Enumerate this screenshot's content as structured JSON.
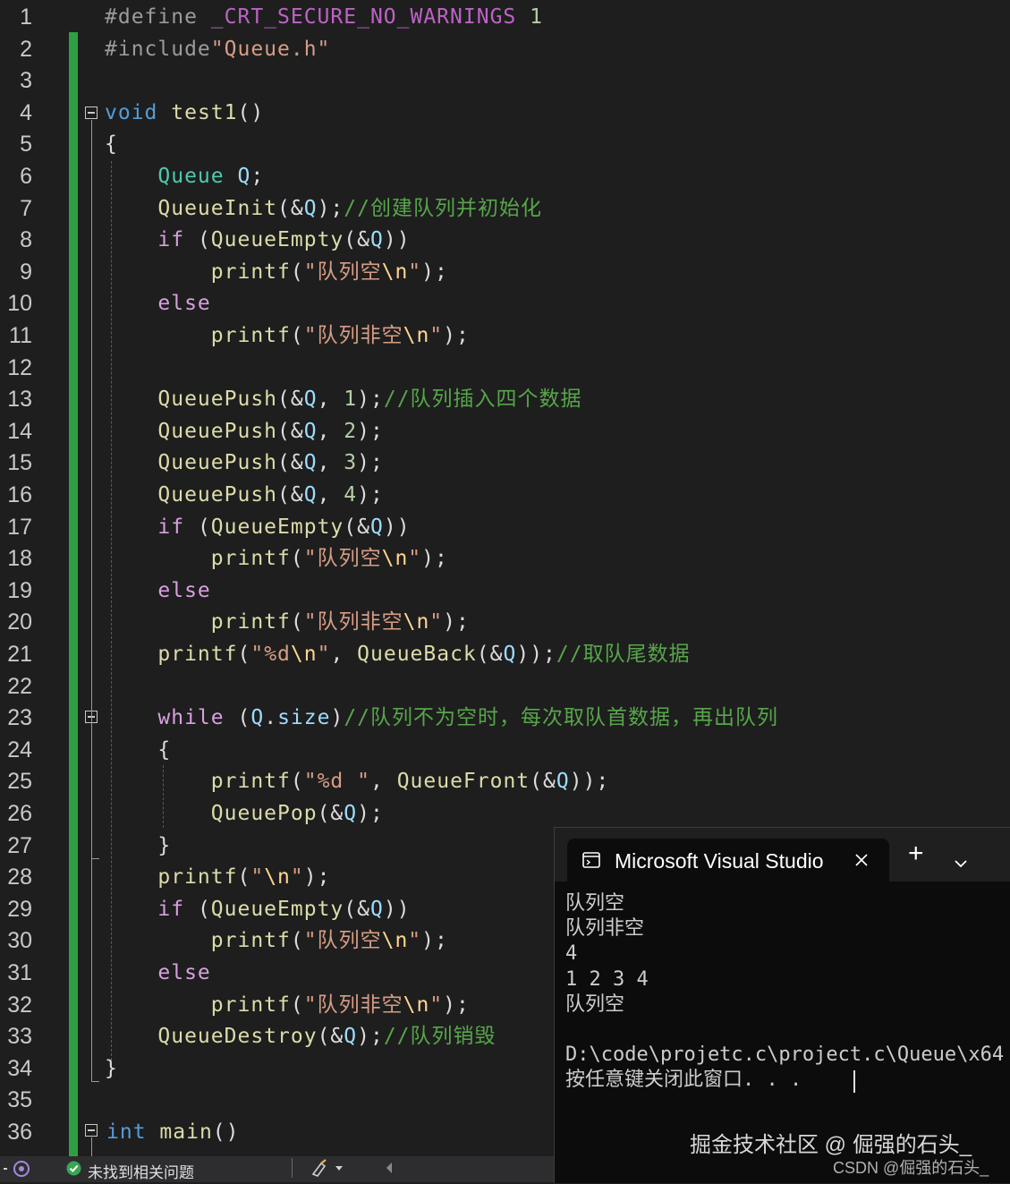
{
  "editor": {
    "line_numbers": [
      "1",
      "2",
      "3",
      "4",
      "5",
      "6",
      "7",
      "8",
      "9",
      "10",
      "11",
      "12",
      "13",
      "14",
      "15",
      "16",
      "17",
      "18",
      "19",
      "20",
      "21",
      "22",
      "23",
      "24",
      "25",
      "26",
      "27",
      "28",
      "29",
      "30",
      "31",
      "32",
      "33",
      "34",
      "35",
      "36"
    ],
    "lines": [
      [
        [
          "pp",
          "#define "
        ],
        [
          "mac",
          "_CRT_SECURE_NO_WARNINGS"
        ],
        [
          "pl",
          " "
        ],
        [
          "num",
          "1"
        ]
      ],
      [
        [
          "pp",
          "#include"
        ],
        [
          "str",
          "\"Queue.h\""
        ]
      ],
      [],
      [
        [
          "kw",
          "void"
        ],
        [
          "pl",
          " "
        ],
        [
          "fn",
          "test1"
        ],
        [
          "pl",
          "()"
        ]
      ],
      [
        [
          "pl",
          "{"
        ]
      ],
      [
        [
          "pl",
          "    "
        ],
        [
          "ty",
          "Queue"
        ],
        [
          "pl",
          " "
        ],
        [
          "var",
          "Q"
        ],
        [
          "pl",
          ";"
        ]
      ],
      [
        [
          "pl",
          "    "
        ],
        [
          "fn",
          "QueueInit"
        ],
        [
          "pl",
          "(&"
        ],
        [
          "var",
          "Q"
        ],
        [
          "pl",
          ");"
        ],
        [
          "cm",
          "//创建队列并初始化"
        ]
      ],
      [
        [
          "pl",
          "    "
        ],
        [
          "ctl",
          "if"
        ],
        [
          "pl",
          " ("
        ],
        [
          "fn",
          "QueueEmpty"
        ],
        [
          "pl",
          "(&"
        ],
        [
          "var",
          "Q"
        ],
        [
          "pl",
          "))"
        ]
      ],
      [
        [
          "pl",
          "        "
        ],
        [
          "fn",
          "printf"
        ],
        [
          "pl",
          "("
        ],
        [
          "str",
          "\"队列空"
        ],
        [
          "esc",
          "\\n"
        ],
        [
          "str",
          "\""
        ],
        [
          "pl",
          ");"
        ]
      ],
      [
        [
          "pl",
          "    "
        ],
        [
          "ctl",
          "else"
        ]
      ],
      [
        [
          "pl",
          "        "
        ],
        [
          "fn",
          "printf"
        ],
        [
          "pl",
          "("
        ],
        [
          "str",
          "\"队列非空"
        ],
        [
          "esc",
          "\\n"
        ],
        [
          "str",
          "\""
        ],
        [
          "pl",
          ");"
        ]
      ],
      [],
      [
        [
          "pl",
          "    "
        ],
        [
          "fn",
          "QueuePush"
        ],
        [
          "pl",
          "(&"
        ],
        [
          "var",
          "Q"
        ],
        [
          "pl",
          ", "
        ],
        [
          "num",
          "1"
        ],
        [
          "pl",
          ");"
        ],
        [
          "cm",
          "//队列插入四个数据"
        ]
      ],
      [
        [
          "pl",
          "    "
        ],
        [
          "fn",
          "QueuePush"
        ],
        [
          "pl",
          "(&"
        ],
        [
          "var",
          "Q"
        ],
        [
          "pl",
          ", "
        ],
        [
          "num",
          "2"
        ],
        [
          "pl",
          ");"
        ]
      ],
      [
        [
          "pl",
          "    "
        ],
        [
          "fn",
          "QueuePush"
        ],
        [
          "pl",
          "(&"
        ],
        [
          "var",
          "Q"
        ],
        [
          "pl",
          ", "
        ],
        [
          "num",
          "3"
        ],
        [
          "pl",
          ");"
        ]
      ],
      [
        [
          "pl",
          "    "
        ],
        [
          "fn",
          "QueuePush"
        ],
        [
          "pl",
          "(&"
        ],
        [
          "var",
          "Q"
        ],
        [
          "pl",
          ", "
        ],
        [
          "num",
          "4"
        ],
        [
          "pl",
          ");"
        ]
      ],
      [
        [
          "pl",
          "    "
        ],
        [
          "ctl",
          "if"
        ],
        [
          "pl",
          " ("
        ],
        [
          "fn",
          "QueueEmpty"
        ],
        [
          "pl",
          "(&"
        ],
        [
          "var",
          "Q"
        ],
        [
          "pl",
          "))"
        ]
      ],
      [
        [
          "pl",
          "        "
        ],
        [
          "fn",
          "printf"
        ],
        [
          "pl",
          "("
        ],
        [
          "str",
          "\"队列空"
        ],
        [
          "esc",
          "\\n"
        ],
        [
          "str",
          "\""
        ],
        [
          "pl",
          ");"
        ]
      ],
      [
        [
          "pl",
          "    "
        ],
        [
          "ctl",
          "else"
        ]
      ],
      [
        [
          "pl",
          "        "
        ],
        [
          "fn",
          "printf"
        ],
        [
          "pl",
          "("
        ],
        [
          "str",
          "\"队列非空"
        ],
        [
          "esc",
          "\\n"
        ],
        [
          "str",
          "\""
        ],
        [
          "pl",
          ");"
        ]
      ],
      [
        [
          "pl",
          "    "
        ],
        [
          "fn",
          "printf"
        ],
        [
          "pl",
          "("
        ],
        [
          "str",
          "\"%d"
        ],
        [
          "esc",
          "\\n"
        ],
        [
          "str",
          "\""
        ],
        [
          "pl",
          ", "
        ],
        [
          "fn",
          "QueueBack"
        ],
        [
          "pl",
          "(&"
        ],
        [
          "var",
          "Q"
        ],
        [
          "pl",
          "));"
        ],
        [
          "cm",
          "//取队尾数据"
        ]
      ],
      [],
      [
        [
          "pl",
          "    "
        ],
        [
          "ctl",
          "while"
        ],
        [
          "pl",
          " ("
        ],
        [
          "var",
          "Q"
        ],
        [
          "pl",
          "."
        ],
        [
          "var",
          "size"
        ],
        [
          "pl",
          ")"
        ],
        [
          "cm",
          "//队列不为空时，每次取队首数据，再出队列"
        ]
      ],
      [
        [
          "pl",
          "    {"
        ]
      ],
      [
        [
          "pl",
          "        "
        ],
        [
          "fn",
          "printf"
        ],
        [
          "pl",
          "("
        ],
        [
          "str",
          "\"%d \""
        ],
        [
          "pl",
          ", "
        ],
        [
          "fn",
          "QueueFront"
        ],
        [
          "pl",
          "(&"
        ],
        [
          "var",
          "Q"
        ],
        [
          "pl",
          "));"
        ]
      ],
      [
        [
          "pl",
          "        "
        ],
        [
          "fn",
          "QueuePop"
        ],
        [
          "pl",
          "(&"
        ],
        [
          "var",
          "Q"
        ],
        [
          "pl",
          ");"
        ]
      ],
      [
        [
          "pl",
          "    }"
        ]
      ],
      [
        [
          "pl",
          "    "
        ],
        [
          "fn",
          "printf"
        ],
        [
          "pl",
          "("
        ],
        [
          "str",
          "\""
        ],
        [
          "esc",
          "\\n"
        ],
        [
          "str",
          "\""
        ],
        [
          "pl",
          ");"
        ]
      ],
      [
        [
          "pl",
          "    "
        ],
        [
          "ctl",
          "if"
        ],
        [
          "pl",
          " ("
        ],
        [
          "fn",
          "QueueEmpty"
        ],
        [
          "pl",
          "(&"
        ],
        [
          "var",
          "Q"
        ],
        [
          "pl",
          "))"
        ]
      ],
      [
        [
          "pl",
          "        "
        ],
        [
          "fn",
          "printf"
        ],
        [
          "pl",
          "("
        ],
        [
          "str",
          "\"队列空"
        ],
        [
          "esc",
          "\\n"
        ],
        [
          "str",
          "\""
        ],
        [
          "pl",
          ");"
        ]
      ],
      [
        [
          "pl",
          "    "
        ],
        [
          "ctl",
          "else"
        ]
      ],
      [
        [
          "pl",
          "        "
        ],
        [
          "fn",
          "printf"
        ],
        [
          "pl",
          "("
        ],
        [
          "str",
          "\"队列非空"
        ],
        [
          "esc",
          "\\n"
        ],
        [
          "str",
          "\""
        ],
        [
          "pl",
          ");"
        ]
      ],
      [
        [
          "pl",
          "    "
        ],
        [
          "fn",
          "QueueDestroy"
        ],
        [
          "pl",
          "(&"
        ],
        [
          "var",
          "Q"
        ],
        [
          "pl",
          ");"
        ],
        [
          "cm",
          "//队列销毁"
        ]
      ],
      [
        [
          "pl",
          "}"
        ]
      ],
      [],
      [
        [
          "kw",
          "int"
        ],
        [
          "pl",
          " "
        ],
        [
          "fn",
          "main"
        ],
        [
          "pl",
          "()"
        ]
      ]
    ]
  },
  "console": {
    "tab_icon": "terminal-icon",
    "tab_title": "Microsoft Visual Studio",
    "close_icon": "close-icon",
    "add_glyph": "+",
    "dropdown_icon": "chevron-down-icon",
    "output_lines": [
      "队列空",
      "队列非空",
      "4",
      "1 2 3 4",
      "队列空",
      "",
      "D:\\code\\projetc.c\\project.c\\Queue\\x64",
      "按任意键关闭此窗口. . ."
    ]
  },
  "statusbar": {
    "issues_icon": "check-circle-icon",
    "issues_text": "未找到相关问题",
    "brush_icon": "brush-icon",
    "arrow_icon": "chevron-left-icon"
  },
  "watermark": {
    "primary": "掘金技术社区 @ 倔强的石头_",
    "secondary": "CSDN @倔强的石头_"
  },
  "colors": {
    "background": "#1e1e1e",
    "keyword": "#569cd6",
    "control": "#d8a0df",
    "string": "#d69d85",
    "type": "#4ec9b0",
    "function": "#dcdcaa",
    "variable": "#9cdcfe",
    "comment": "#57a64a",
    "change_bar": "#2ea043"
  }
}
